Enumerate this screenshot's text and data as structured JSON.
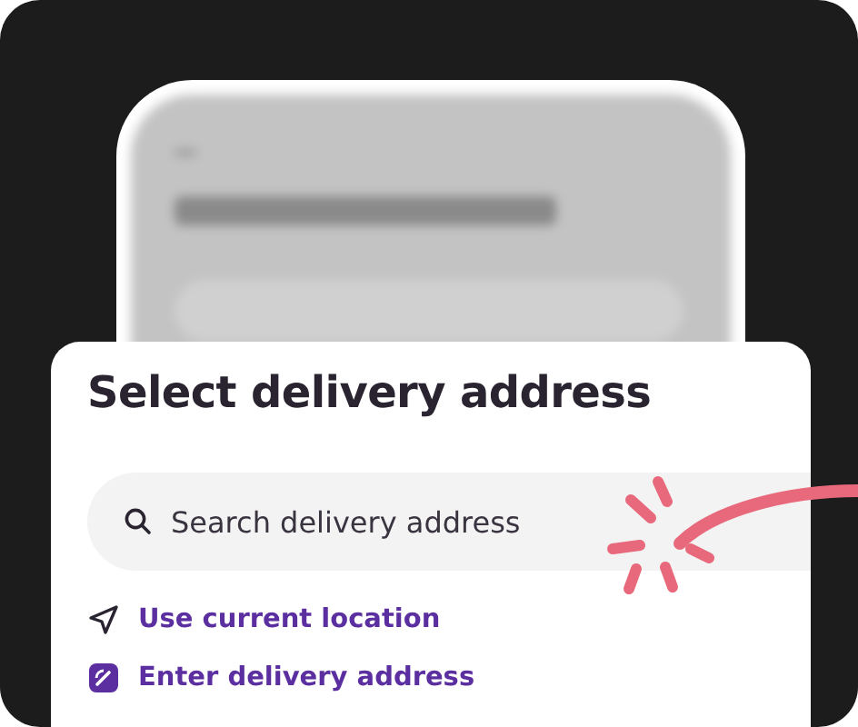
{
  "card": {
    "title": "Select delivery address",
    "search": {
      "placeholder": "Search delivery address"
    },
    "actions": [
      {
        "kind": "location",
        "label": "Use current location"
      },
      {
        "kind": "edit",
        "label": "Enter delivery address"
      }
    ]
  }
}
